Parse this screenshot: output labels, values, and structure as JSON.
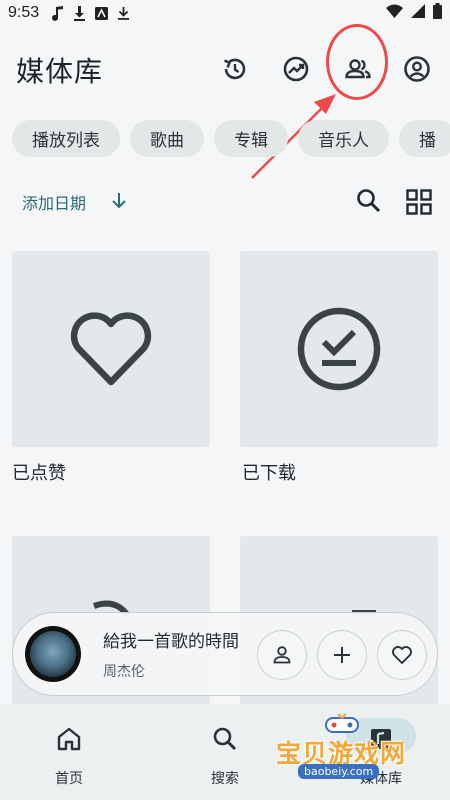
{
  "status_bar": {
    "time": "9:53",
    "left_icons": [
      "music-note-icon",
      "download-icon",
      "news-app-icon",
      "download-icon"
    ],
    "right_icons": [
      "wifi-icon",
      "signal-icon",
      "battery-icon"
    ]
  },
  "header": {
    "title": "媒体库",
    "actions": [
      "history-icon",
      "trending-icon",
      "people-icon",
      "account-icon"
    ],
    "annotation_color": "#ee4a4a"
  },
  "chips": [
    "播放列表",
    "歌曲",
    "专辑",
    "音乐人",
    "播"
  ],
  "sort": {
    "label": "添加日期"
  },
  "cards": [
    {
      "label": "已点赞",
      "icon": "heart-icon"
    },
    {
      "label": "已下载",
      "icon": "download-done-icon"
    }
  ],
  "mini_player": {
    "song": "給我一首歌的時間",
    "artist": "周杰伦"
  },
  "bottom_nav": {
    "items": [
      {
        "label": "首页",
        "icon": "home-icon"
      },
      {
        "label": "搜索",
        "icon": "search-icon"
      },
      {
        "label": "媒体库",
        "icon": "library-icon"
      }
    ]
  },
  "watermark": {
    "text": "宝贝游戏网",
    "url": "baobeiy.com"
  },
  "colors": {
    "accent": "#2c6b73",
    "background": "#f4f6f7",
    "chip": "#e3e7e8",
    "card": "#e4e8ea"
  }
}
